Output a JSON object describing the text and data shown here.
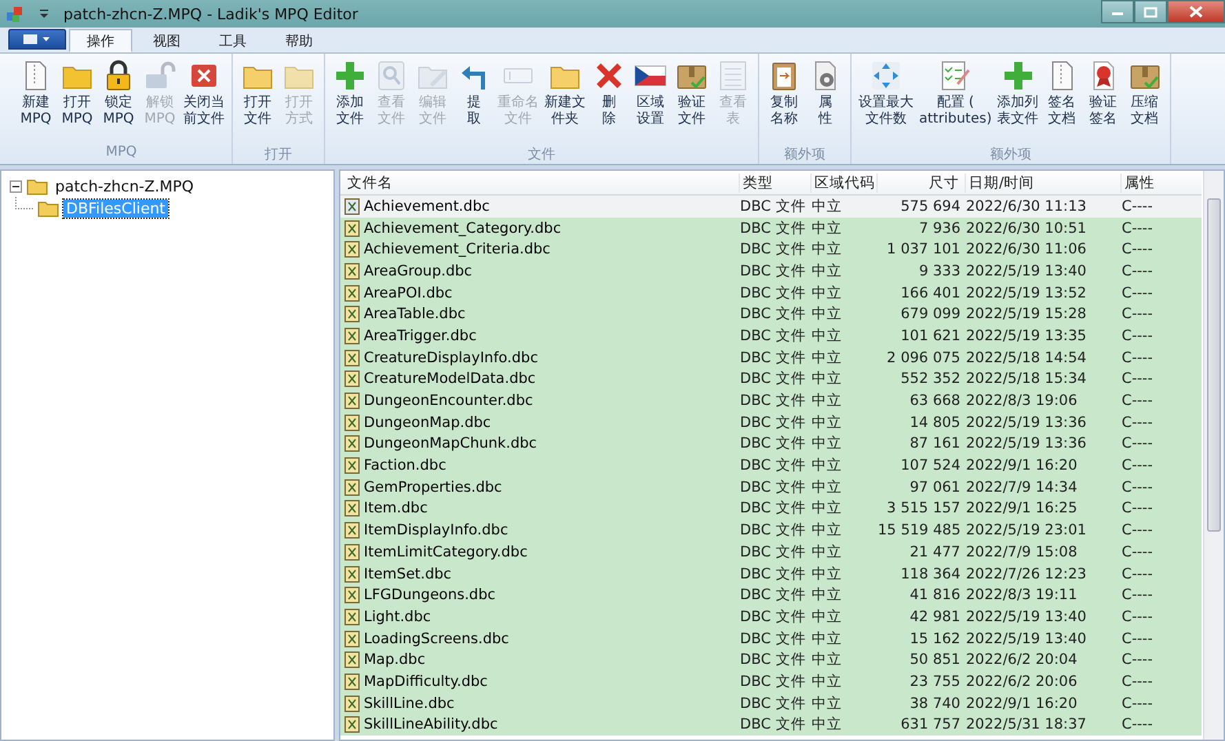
{
  "window": {
    "title": "patch-zhcn-Z.MPQ - Ladik's MPQ Editor"
  },
  "tabs": [
    {
      "label": "操作",
      "selected": true
    },
    {
      "label": "视图",
      "selected": false
    },
    {
      "label": "工具",
      "selected": false
    },
    {
      "label": "帮助",
      "selected": false
    }
  ],
  "ribbon": [
    {
      "label": "MPQ",
      "buttons": [
        {
          "lines": [
            "新建",
            "MPQ"
          ],
          "disabled": false
        },
        {
          "lines": [
            "打开",
            "MPQ"
          ],
          "disabled": false
        },
        {
          "lines": [
            "锁定",
            "MPQ"
          ],
          "disabled": false
        },
        {
          "lines": [
            "解锁",
            "MPQ"
          ],
          "disabled": true
        },
        {
          "lines": [
            "关闭当",
            "前文件"
          ],
          "disabled": false
        }
      ]
    },
    {
      "label": "打开",
      "buttons": [
        {
          "lines": [
            "打开",
            "文件"
          ],
          "disabled": false
        },
        {
          "lines": [
            "打开",
            "方式"
          ],
          "disabled": true
        }
      ]
    },
    {
      "label": "文件",
      "buttons": [
        {
          "lines": [
            "添加",
            "文件"
          ],
          "disabled": false
        },
        {
          "lines": [
            "查看",
            "文件"
          ],
          "disabled": true
        },
        {
          "lines": [
            "编辑",
            "文件"
          ],
          "disabled": true
        },
        {
          "lines": [
            "提",
            "取"
          ],
          "disabled": false
        },
        {
          "lines": [
            "重命名",
            "文件"
          ],
          "disabled": true
        },
        {
          "lines": [
            "新建文",
            "件夹"
          ],
          "disabled": false
        },
        {
          "lines": [
            "删",
            "除"
          ],
          "disabled": false
        },
        {
          "lines": [
            "区域",
            "设置"
          ],
          "disabled": false
        },
        {
          "lines": [
            "验证",
            "文件"
          ],
          "disabled": false
        },
        {
          "lines": [
            "查看",
            "表"
          ],
          "disabled": true
        }
      ]
    },
    {
      "label": "额外项",
      "buttons": [
        {
          "lines": [
            "复制",
            "名称"
          ],
          "disabled": false
        },
        {
          "lines": [
            "属",
            "性"
          ],
          "disabled": false
        }
      ]
    },
    {
      "label": "额外项",
      "buttons": [
        {
          "lines": [
            "设置最大",
            "文件数"
          ],
          "disabled": false
        },
        {
          "lines": [
            "配置 (",
            "attributes)"
          ],
          "disabled": false
        },
        {
          "lines": [
            "添加列",
            "表文件"
          ],
          "disabled": false
        },
        {
          "lines": [
            "签名",
            "文档"
          ],
          "disabled": false
        },
        {
          "lines": [
            "验证",
            "签名"
          ],
          "disabled": false
        },
        {
          "lines": [
            "压缩",
            "文档"
          ],
          "disabled": false
        }
      ]
    }
  ],
  "tree": [
    {
      "label": "patch-zhcn-Z.MPQ",
      "expanded": true,
      "selected": false,
      "children": [
        {
          "label": "DBFilesClient",
          "selected": true
        }
      ]
    }
  ],
  "table": {
    "columns": [
      "文件名",
      "类型",
      "区域代码",
      "尺寸",
      "日期/时间",
      "属性"
    ],
    "rows": [
      {
        "cells": [
          "Achievement.dbc",
          "DBC 文件",
          "中立",
          "575 694",
          "2022/6/30 11:13",
          "C----"
        ],
        "selected": false
      },
      {
        "cells": [
          "Achievement_Category.dbc",
          "DBC 文件",
          "中立",
          "7 936",
          "2022/6/30 10:51",
          "C----"
        ],
        "selected": true
      },
      {
        "cells": [
          "Achievement_Criteria.dbc",
          "DBC 文件",
          "中立",
          "1 037 101",
          "2022/6/30 11:06",
          "C----"
        ],
        "selected": true
      },
      {
        "cells": [
          "AreaGroup.dbc",
          "DBC 文件",
          "中立",
          "9 333",
          "2022/5/19 13:40",
          "C----"
        ],
        "selected": true
      },
      {
        "cells": [
          "AreaPOI.dbc",
          "DBC 文件",
          "中立",
          "166 401",
          "2022/5/19 13:52",
          "C----"
        ],
        "selected": true
      },
      {
        "cells": [
          "AreaTable.dbc",
          "DBC 文件",
          "中立",
          "679 099",
          "2022/5/19 15:28",
          "C----"
        ],
        "selected": true
      },
      {
        "cells": [
          "AreaTrigger.dbc",
          "DBC 文件",
          "中立",
          "101 621",
          "2022/5/19 13:35",
          "C----"
        ],
        "selected": true
      },
      {
        "cells": [
          "CreatureDisplayInfo.dbc",
          "DBC 文件",
          "中立",
          "2 096 075",
          "2022/5/18 14:54",
          "C----"
        ],
        "selected": true
      },
      {
        "cells": [
          "CreatureModelData.dbc",
          "DBC 文件",
          "中立",
          "552 352",
          "2022/5/18 15:34",
          "C----"
        ],
        "selected": true
      },
      {
        "cells": [
          "DungeonEncounter.dbc",
          "DBC 文件",
          "中立",
          "63 668",
          "2022/8/3 19:06",
          "C----"
        ],
        "selected": true
      },
      {
        "cells": [
          "DungeonMap.dbc",
          "DBC 文件",
          "中立",
          "14 805",
          "2022/5/19 13:36",
          "C----"
        ],
        "selected": true
      },
      {
        "cells": [
          "DungeonMapChunk.dbc",
          "DBC 文件",
          "中立",
          "87 161",
          "2022/5/19 13:36",
          "C----"
        ],
        "selected": true
      },
      {
        "cells": [
          "Faction.dbc",
          "DBC 文件",
          "中立",
          "107 524",
          "2022/9/1 16:20",
          "C----"
        ],
        "selected": true
      },
      {
        "cells": [
          "GemProperties.dbc",
          "DBC 文件",
          "中立",
          "97 061",
          "2022/7/9 14:34",
          "C----"
        ],
        "selected": true
      },
      {
        "cells": [
          "Item.dbc",
          "DBC 文件",
          "中立",
          "3 515 157",
          "2022/9/1 16:25",
          "C----"
        ],
        "selected": true
      },
      {
        "cells": [
          "ItemDisplayInfo.dbc",
          "DBC 文件",
          "中立",
          "15 519 485",
          "2022/5/19 23:01",
          "C----"
        ],
        "selected": true
      },
      {
        "cells": [
          "ItemLimitCategory.dbc",
          "DBC 文件",
          "中立",
          "21 477",
          "2022/7/9 15:08",
          "C----"
        ],
        "selected": true
      },
      {
        "cells": [
          "ItemSet.dbc",
          "DBC 文件",
          "中立",
          "118 364",
          "2022/7/26 12:23",
          "C----"
        ],
        "selected": true
      },
      {
        "cells": [
          "LFGDungeons.dbc",
          "DBC 文件",
          "中立",
          "41 816",
          "2022/8/3 19:11",
          "C----"
        ],
        "selected": true
      },
      {
        "cells": [
          "Light.dbc",
          "DBC 文件",
          "中立",
          "42 981",
          "2022/5/19 13:40",
          "C----"
        ],
        "selected": true
      },
      {
        "cells": [
          "LoadingScreens.dbc",
          "DBC 文件",
          "中立",
          "15 162",
          "2022/5/19 13:40",
          "C----"
        ],
        "selected": true
      },
      {
        "cells": [
          "Map.dbc",
          "DBC 文件",
          "中立",
          "50 851",
          "2022/6/2 20:04",
          "C----"
        ],
        "selected": true
      },
      {
        "cells": [
          "MapDifficulty.dbc",
          "DBC 文件",
          "中立",
          "23 755",
          "2022/6/2 20:06",
          "C----"
        ],
        "selected": true
      },
      {
        "cells": [
          "SkillLine.dbc",
          "DBC 文件",
          "中立",
          "38 740",
          "2022/9/1 16:20",
          "C----"
        ],
        "selected": true
      },
      {
        "cells": [
          "SkillLineAbility.dbc",
          "DBC 文件",
          "中立",
          "631 757",
          "2022/5/31 18:37",
          "C----"
        ],
        "selected": true
      }
    ]
  }
}
